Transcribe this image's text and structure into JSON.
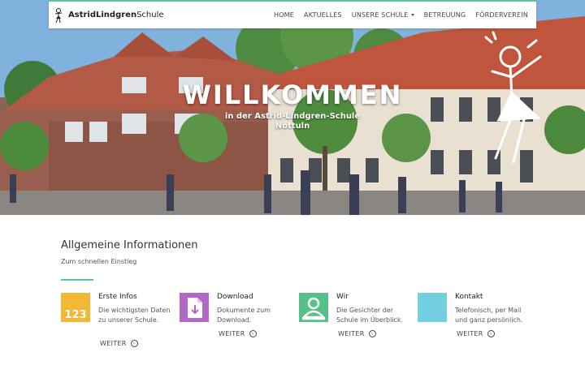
{
  "brand": {
    "name_bold": "AstridLindgren",
    "name_rest": "Schule",
    "logo_icon": "stick-figure-logo-icon"
  },
  "nav": {
    "items": [
      "HOME",
      "AKTUELLES",
      "UNSERE SCHULE",
      "BETREUUNG",
      "FÖRDERVEREIN"
    ]
  },
  "hero": {
    "title": "WILLKOMMEN",
    "subtitle_line1": "in der Astrid-Lindgren-Schule",
    "subtitle_line2": "Nottuln"
  },
  "info": {
    "title": "Allgemeine Informationen",
    "subtitle": "Zum schnellen Einstieg",
    "accent": "#5cc0a8"
  },
  "cards": [
    {
      "title": "Erste Infos",
      "text": "Die wichtigsten Daten zu unserer Schule.",
      "link": "WEITER",
      "icon_color": "#f2b733",
      "icon_label": "123",
      "icon": "numbers-icon"
    },
    {
      "title": "Download",
      "text": "Dokumente zum Download.",
      "link": "WEITER",
      "icon_color": "#b367c6",
      "icon": "download-document-icon"
    },
    {
      "title": "Wir",
      "text": "Die Gesichter der Schule im Überblick.",
      "link": "WEITER",
      "icon_color": "#55c08a",
      "icon": "person-icon"
    },
    {
      "title": "Kontakt",
      "text": "Telefonisch, per Mail und ganz persönlich.",
      "link": "WEITER",
      "icon_color": "#72cfe0",
      "icon": "contact-icon"
    }
  ]
}
